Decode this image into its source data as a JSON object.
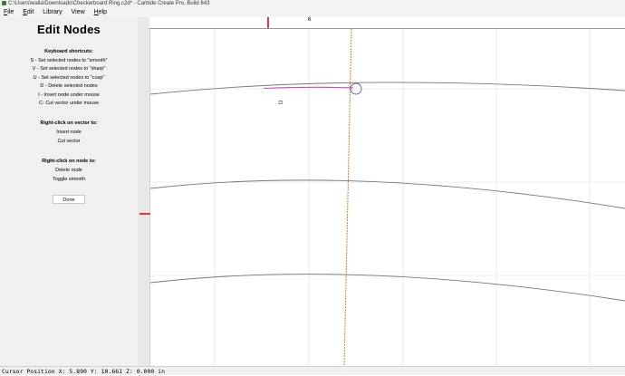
{
  "window": {
    "title": "C:\\Users\\walla\\Downloads\\Checkerboard Ring.c2d* - Carbide Create Pro, Build 843"
  },
  "menu": {
    "items": [
      {
        "underline": "F",
        "rest": "ile"
      },
      {
        "underline": "E",
        "rest": "dit"
      },
      {
        "underline": "",
        "rest": "Library"
      },
      {
        "underline": "",
        "rest": "View"
      },
      {
        "underline": "H",
        "rest": "elp"
      }
    ]
  },
  "panel": {
    "heading": "Edit Nodes",
    "keyboard_title": "Keyboard shortcuts:",
    "keyboard_items": [
      "S - Set selected nodes to \"smooth\"",
      "V - Set selected nodes to \"sharp\"",
      "U - Set selected nodes to \"cusp\"",
      "D - Delete selected nodes",
      "I - Insert node under mouse",
      "C- Cut vector under mouse"
    ],
    "vector_title": "Right-click on vector to:",
    "vector_items": [
      "Insert node",
      "Cut vector"
    ],
    "node_title": "Right-click on node to:",
    "node_items": [
      "Delete node",
      "Toggle smooth"
    ],
    "done_label": "Done"
  },
  "ruler": {
    "top_label": "6",
    "left_label": "11"
  },
  "status": {
    "text": "Cursor Position X: 5.890 Y: 10.661 Z: 0.000 in"
  },
  "colors": {
    "curve": "#777777",
    "selected_curve": "#c44fc4",
    "toolpath": "#f07a2a",
    "marker": "#e83a3a",
    "grid": "#dddddd",
    "node_ring": "#5a5aa8"
  }
}
